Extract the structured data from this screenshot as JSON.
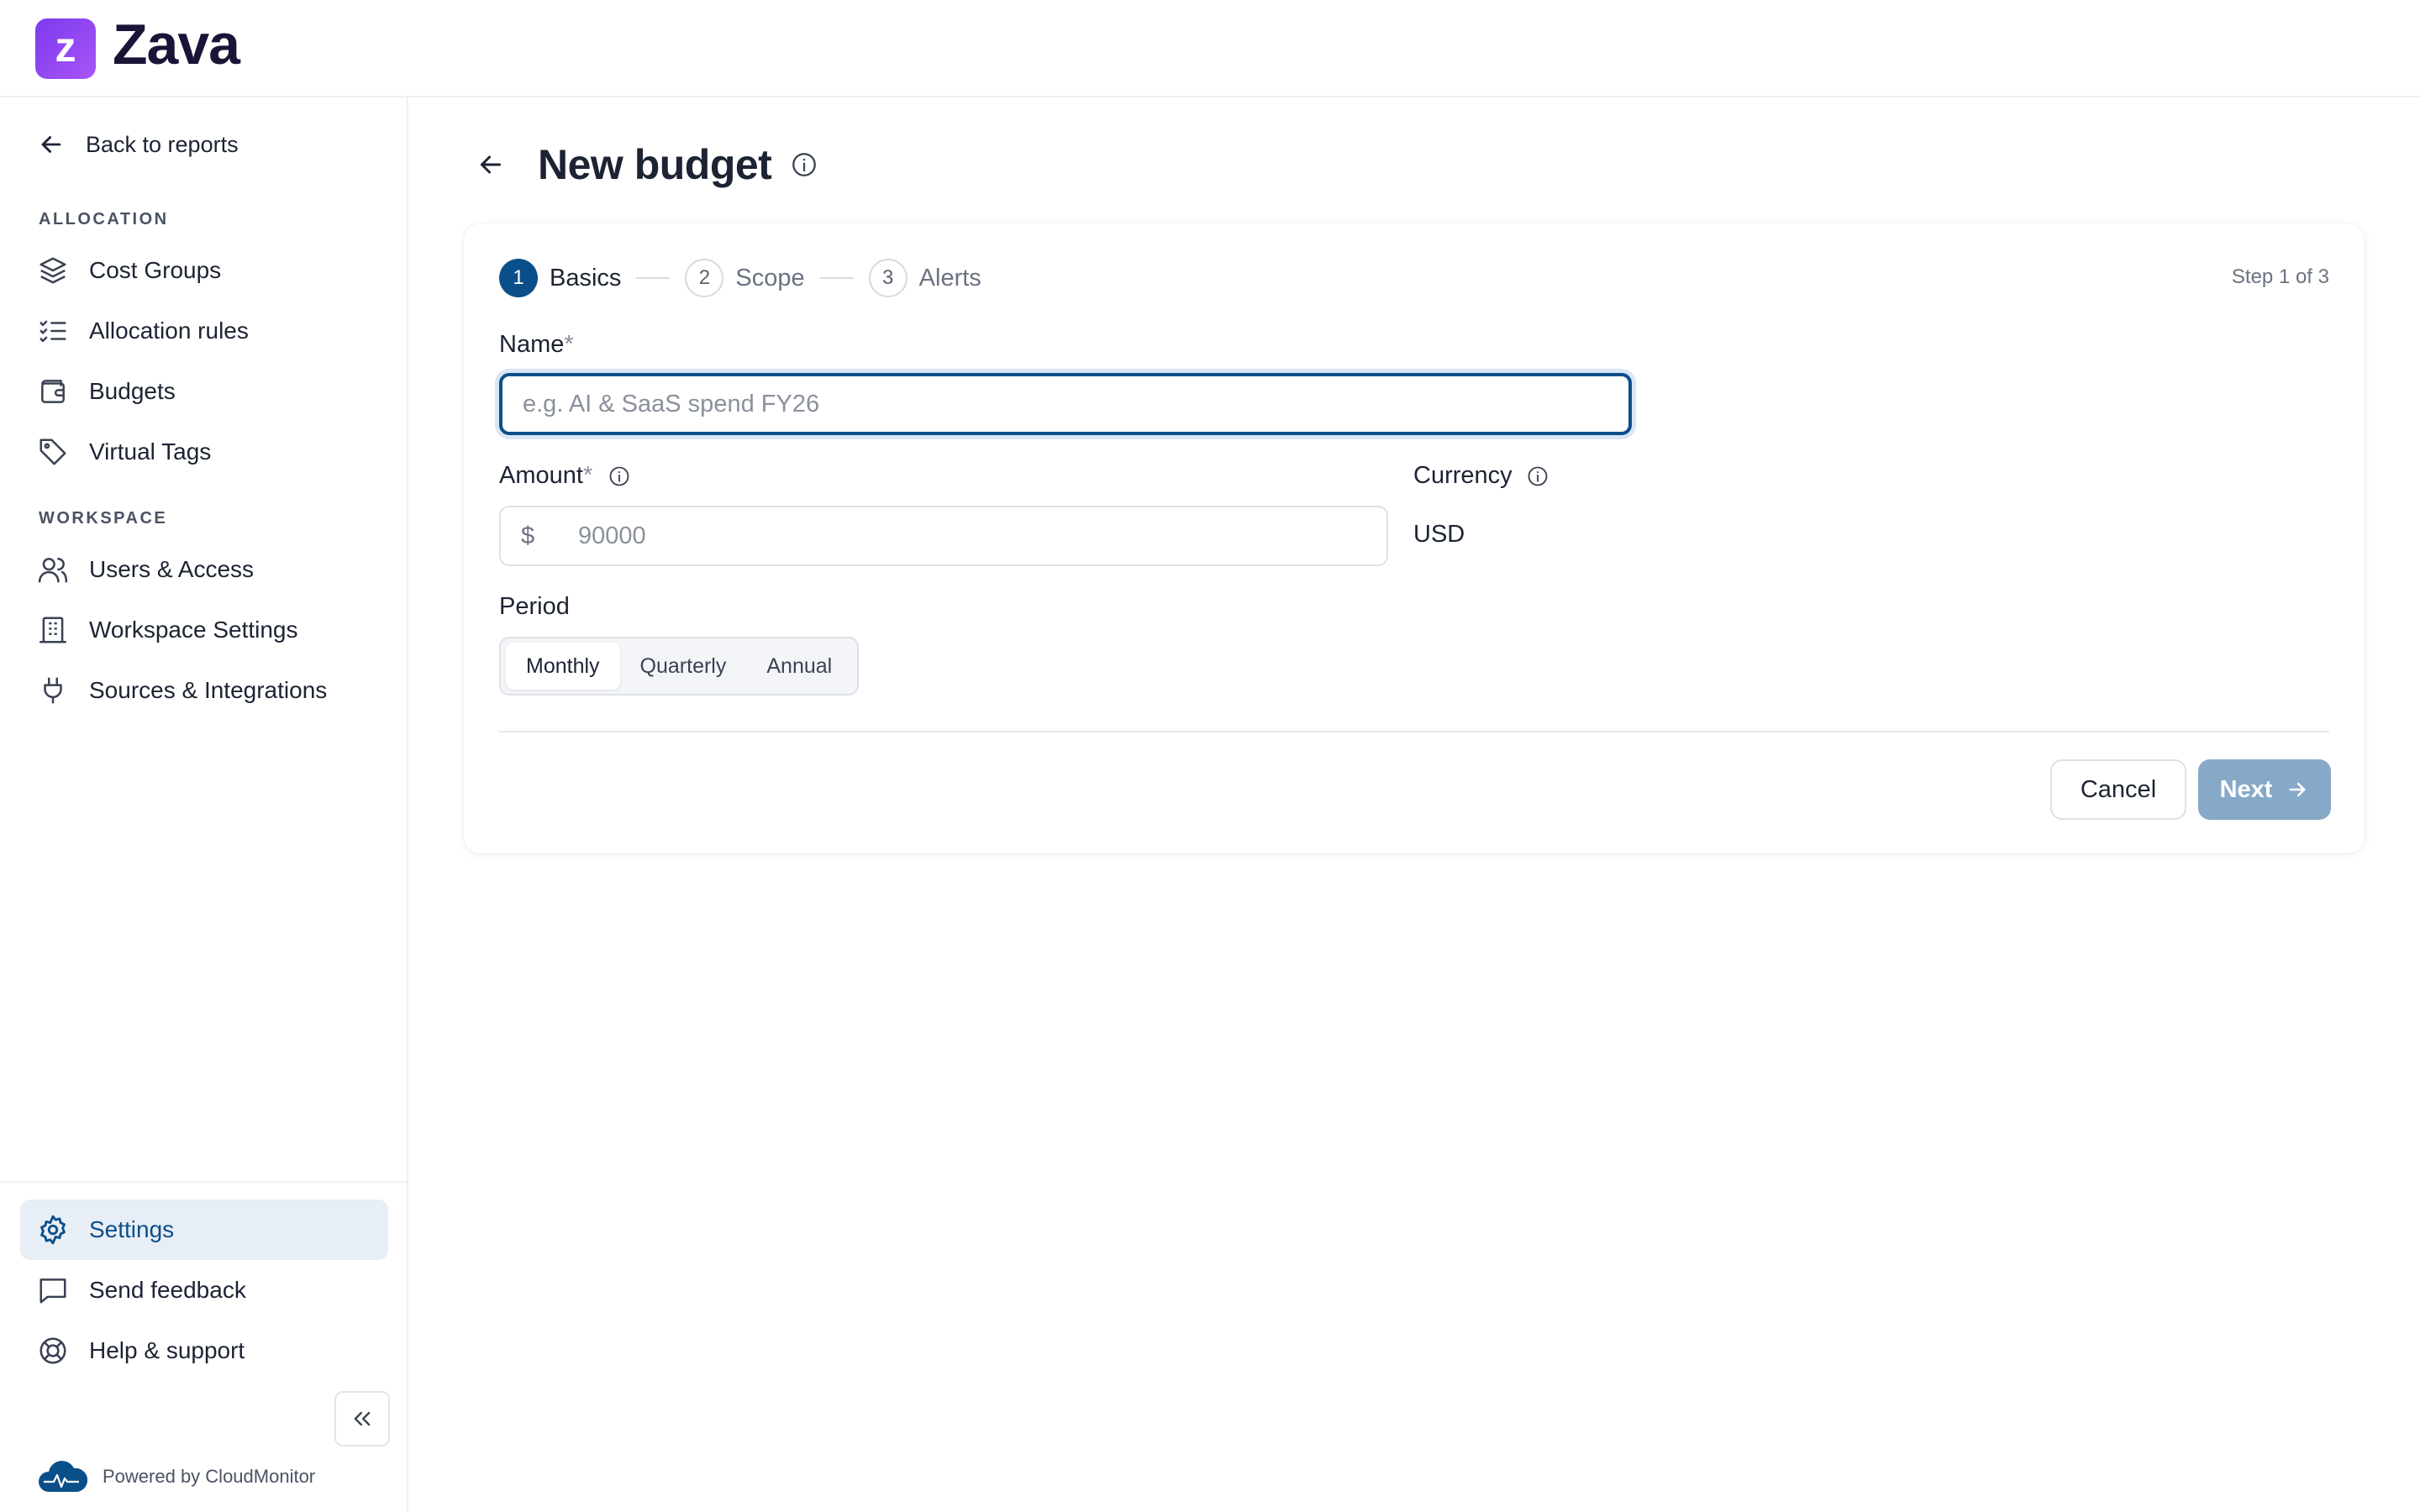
{
  "brand": {
    "logo_letter": "z",
    "name": "Zava",
    "accent_color": "#7c3aed"
  },
  "sidebar": {
    "back_label": "Back to reports",
    "allocation_heading": "ALLOCATION",
    "allocation_items": [
      {
        "label": "Cost Groups",
        "icon": "layers-icon"
      },
      {
        "label": "Allocation rules",
        "icon": "checklist-icon"
      },
      {
        "label": "Budgets",
        "icon": "wallet-icon"
      },
      {
        "label": "Virtual Tags",
        "icon": "tag-icon"
      }
    ],
    "workspace_heading": "WORKSPACE",
    "workspace_items": [
      {
        "label": "Users & Access",
        "icon": "users-icon"
      },
      {
        "label": "Workspace Settings",
        "icon": "building-icon"
      },
      {
        "label": "Sources & Integrations",
        "icon": "plug-icon"
      }
    ],
    "bottom_items": [
      {
        "label": "Settings",
        "icon": "gear-icon",
        "active": true
      },
      {
        "label": "Send feedback",
        "icon": "message-icon"
      },
      {
        "label": "Help & support",
        "icon": "lifebuoy-icon"
      }
    ],
    "powered_by": "Powered by CloudMonitor"
  },
  "page": {
    "title": "New budget"
  },
  "wizard": {
    "steps": [
      {
        "number": "1",
        "label": "Basics",
        "active": true
      },
      {
        "number": "2",
        "label": "Scope",
        "active": false
      },
      {
        "number": "3",
        "label": "Alerts",
        "active": false
      }
    ],
    "step_counter": "Step 1 of 3",
    "name_label": "Name",
    "name_required_mark": "*",
    "name_value": "",
    "name_placeholder": "e.g. AI & SaaS spend FY26",
    "amount_label": "Amount",
    "amount_required_mark": "*",
    "amount_currency_symbol": "$",
    "amount_value": "",
    "amount_placeholder": "90000",
    "currency_label": "Currency",
    "currency_value": "USD",
    "period_label": "Period",
    "period_options": [
      "Monthly",
      "Quarterly",
      "Annual"
    ],
    "period_selected": "Monthly",
    "cancel_label": "Cancel",
    "next_label": "Next"
  },
  "colors": {
    "primary": "#0b4f8a",
    "next_disabled": "#87a9c8",
    "active_nav_bg": "#e8eef5"
  }
}
